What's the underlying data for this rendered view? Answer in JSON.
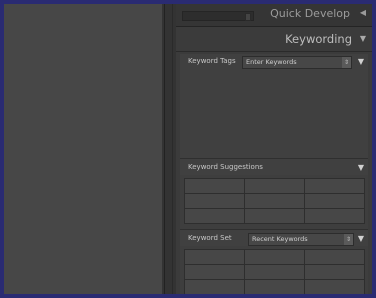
{
  "panels": {
    "quick_develop": {
      "title": "Quick Develop",
      "arrow": "◀"
    },
    "keywording": {
      "title": "Keywording",
      "arrow": "▼",
      "keyword_tags": {
        "label": "Keyword Tags",
        "select_value": "Enter Keywords",
        "arrow": "▼"
      },
      "keyword_suggestions": {
        "label": "Keyword Suggestions",
        "arrow": "▼",
        "cells": [
          "",
          "",
          "",
          "",
          "",
          "",
          "",
          "",
          ""
        ]
      },
      "keyword_set": {
        "label": "Keyword Set",
        "select_value": "Recent Keywords",
        "arrow": "▼",
        "cells": [
          "",
          "",
          "",
          "",
          "",
          "",
          "",
          "",
          ""
        ]
      }
    }
  },
  "colors": {
    "background": "#2a2b72",
    "panel": "#3b3b3b",
    "main_view": "#474747"
  }
}
